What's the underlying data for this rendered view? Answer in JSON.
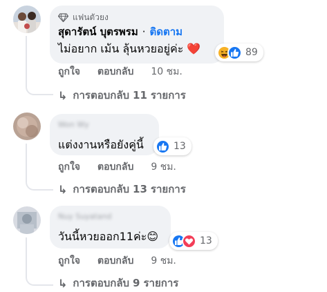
{
  "comments": [
    {
      "badge": "แฟนตัวยง",
      "author": "สุดารัตน์ บุตรพรม",
      "separator": "·",
      "follow_label": "ติดตาม",
      "text": "ไม่อยาก เม้น ลุ้นหวยอยู่ค่ะ ❤️",
      "reaction_count": "89",
      "reaction_icons": [
        "haha-icon",
        "like-icon"
      ],
      "like_label": "ถูกใจ",
      "reply_label": "ตอบกลับ",
      "time": "10 ชม.",
      "replies_prefix": "การตอบกลับ",
      "replies_count": "11",
      "replies_suffix": "รายการ"
    },
    {
      "author_blurred": "Won Wy",
      "text": "แต่งงานหรือยังคู่นี้",
      "reaction_count": "13",
      "reaction_icons": [
        "like-icon"
      ],
      "like_label": "ถูกใจ",
      "reply_label": "ตอบกลับ",
      "time": "9 ชม.",
      "replies_prefix": "การตอบกลับ",
      "replies_count": "13",
      "replies_suffix": "รายการ"
    },
    {
      "author_blurred": "Nuy Suyatand",
      "text": "วันนี้หวยออก11ค่ะ😊",
      "reaction_count": "13",
      "reaction_icons": [
        "like-icon",
        "love-icon"
      ],
      "like_label": "ถูกใจ",
      "reply_label": "ตอบกลับ",
      "time": "9 ชม.",
      "replies_prefix": "การตอบกลับ",
      "replies_count": "9",
      "replies_suffix": "รายการ"
    }
  ],
  "colors": {
    "bubble": "#f0f2f5",
    "secondary_text": "#65676b",
    "link_blue": "#1877f2",
    "like_blue": "#1877f2",
    "love_red": "#f33e58",
    "haha_yellow": "#f7b125"
  }
}
